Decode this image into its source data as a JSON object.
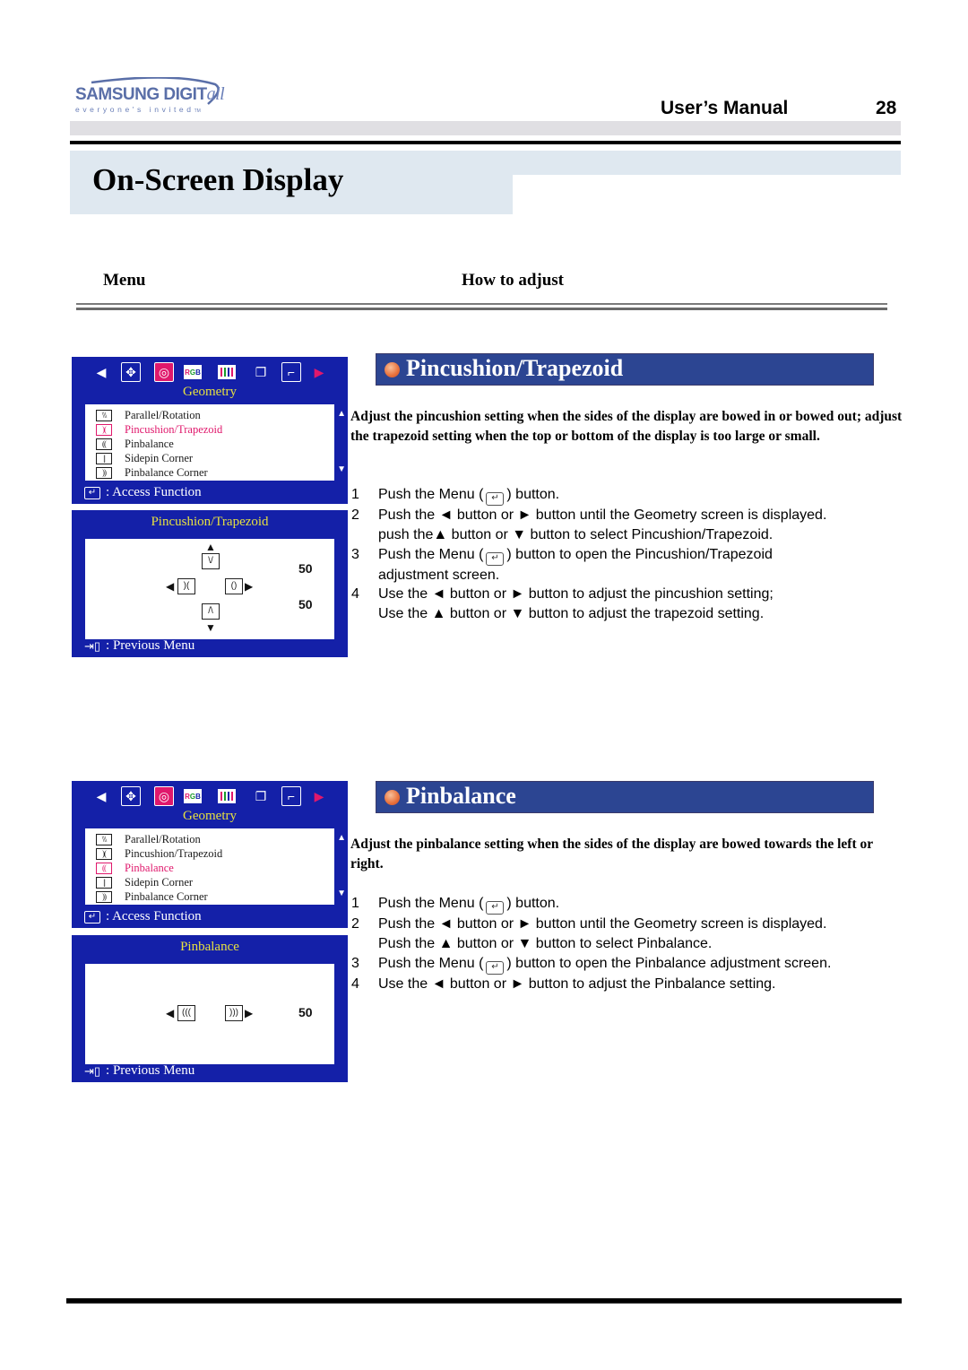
{
  "header": {
    "brand": "SAMSUNG DIGIT",
    "brand_suffix": "all",
    "tagline": "everyone's invited",
    "tagline_tm": "TM",
    "manual_title": "User’s Manual",
    "page_number": "28",
    "page_title": "On-Screen Display"
  },
  "columns": {
    "menu": "Menu",
    "how_to_adjust": "How to adjust"
  },
  "osd_common": {
    "menu_title": "Geometry",
    "access_function": ": Access Function",
    "previous_menu": ": Previous Menu",
    "rgb_icon": [
      "R",
      "G",
      "B"
    ],
    "items": [
      "Parallel/Rotation",
      "Pincushion/Trapezoid",
      "Pinbalance",
      "Sidepin Corner",
      "Pinbalance Corner"
    ]
  },
  "sections": [
    {
      "title": "Pincushion/Trapezoid",
      "active_item": "Pincushion/Trapezoid",
      "adjust_screen_title": "Pincushion/Trapezoid",
      "values": [
        "50",
        "50"
      ],
      "description": "Adjust the pincushion setting when the sides of the display are bowed in or bowed out; adjust the trapezoid setting when the top or bottom of the display is too large or small.",
      "steps": [
        {
          "num": "1",
          "parts": [
            "Push the Menu (",
            ") button."
          ]
        },
        {
          "num": "2",
          "lines": [
            "Push the ◄ button or ► button until the Geometry screen is displayed.",
            "push the▲ button or ▼ button to select Pincushion/Trapezoid."
          ]
        },
        {
          "num": "3",
          "parts": [
            "Push the Menu (",
            ") button to open the Pincushion/Trapezoid"
          ],
          "cont": "adjustment screen."
        },
        {
          "num": "4",
          "lines": [
            "Use the ◄ button or ► button to adjust the pincushion setting;",
            "Use the ▲ button or ▼ button to adjust the trapezoid setting."
          ]
        }
      ]
    },
    {
      "title": "Pinbalance",
      "active_item": "Pinbalance",
      "adjust_screen_title": "Pinbalance",
      "values": [
        "50"
      ],
      "description": "Adjust the pinbalance setting when the sides of the display are bowed towards the left or right.",
      "steps": [
        {
          "num": "1",
          "parts": [
            "Push the Menu (",
            ") button."
          ]
        },
        {
          "num": "2",
          "lines": [
            "Push the ◄ button or ► button until the Geometry screen is displayed.",
            "Push the ▲ button or ▼ button to select Pinbalance."
          ]
        },
        {
          "num": "3",
          "parts": [
            "Push the Menu (",
            ") button to open the Pinbalance adjustment screen."
          ]
        },
        {
          "num": "4",
          "lines": [
            "Use the ◄ button or ► button to adjust the Pinbalance setting."
          ]
        }
      ]
    }
  ],
  "colors": {
    "osd_blue": "#1420a8",
    "osd_highlight": "#e0186c",
    "osd_title_yellow": "#e6e040",
    "section_header_blue": "#2c4592",
    "title_band": "#dfe8f0"
  }
}
